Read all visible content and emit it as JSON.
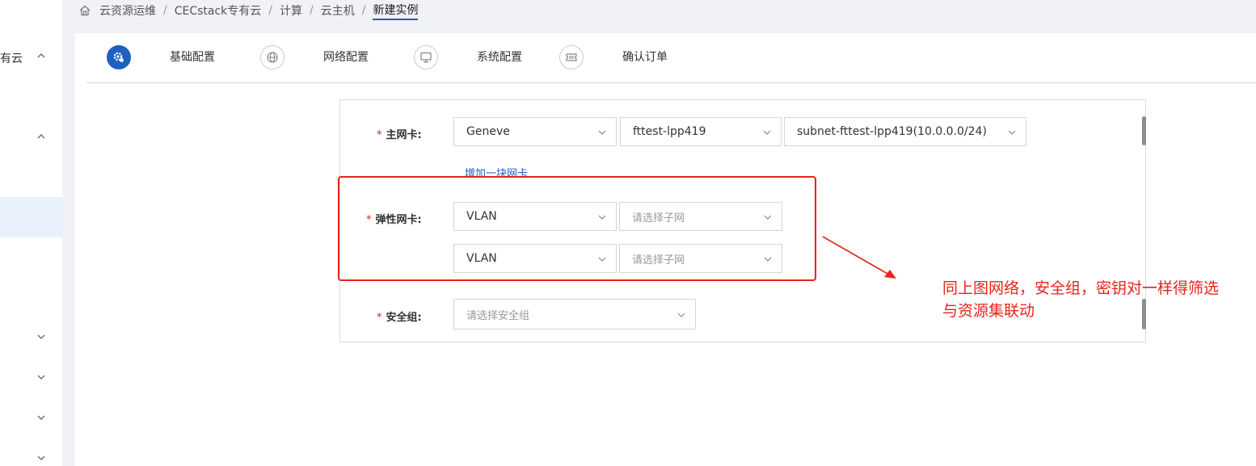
{
  "breadcrumb": [
    "云资源运维",
    "CECstack专有云",
    "计算",
    "云主机"
  ],
  "breadcrumb_current": "新建实例",
  "sidebar": {
    "partial_label": "有云"
  },
  "steps": [
    {
      "label": "基础配置",
      "icon": "gear-icon",
      "active": true
    },
    {
      "label": "网络配置",
      "icon": "globe-icon",
      "active": false
    },
    {
      "label": "系统配置",
      "icon": "monitor-icon",
      "active": false
    },
    {
      "label": "确认订单",
      "icon": "ticket-icon",
      "active": false
    }
  ],
  "form": {
    "primary_nic": {
      "label": "主网卡:",
      "network_type": "Geneve",
      "network": "fttest-lpp419",
      "subnet": "subnet-fttest-lpp419(10.0.0.0/24)"
    },
    "add_nic_link": "增加一块网卡",
    "elastic_nic": {
      "label": "弹性网卡:",
      "rows": [
        {
          "type": "VLAN",
          "subnet_placeholder": "请选择子网"
        },
        {
          "type": "VLAN",
          "subnet_placeholder": "请选择子网"
        }
      ]
    },
    "security_group": {
      "label": "安全组:",
      "placeholder": "请选择安全组"
    }
  },
  "annotation": {
    "line1": "同上图网络，安全组，密钥对一样得筛选",
    "line2": "与资源集联动",
    "color": "#e8231a"
  },
  "accent_color": "#1f5fbf"
}
